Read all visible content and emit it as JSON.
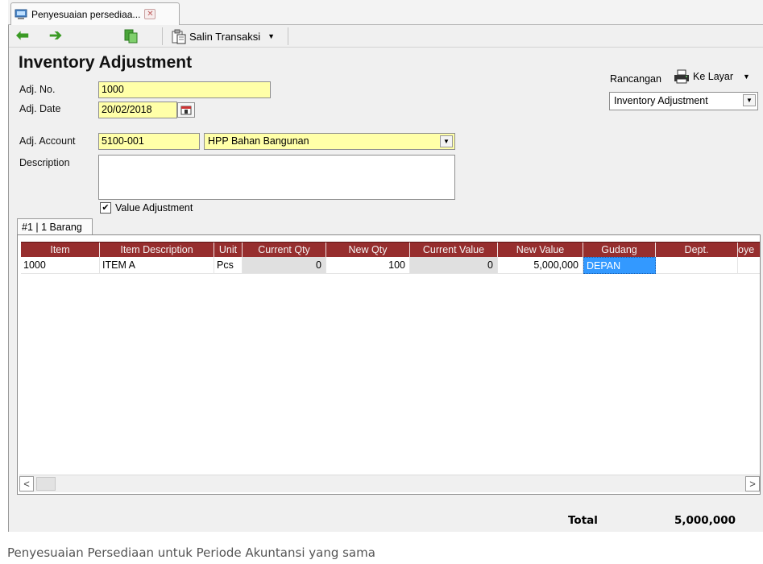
{
  "tab": {
    "title": "Penyesuaian persediaa...",
    "close_label": "✕"
  },
  "toolbar": {
    "back_icon": "arrow-left-icon",
    "forward_icon": "arrow-right-icon",
    "copy_icon": "copy-document-icon",
    "salin_label": "Salin Transaksi",
    "dropdown_caret": "▼"
  },
  "form": {
    "title": "Inventory Adjustment",
    "adj_no_label": "Adj. No.",
    "adj_no_value": "1000",
    "adj_date_label": "Adj. Date",
    "adj_date_value": "20/02/2018",
    "adj_account_label": "Adj. Account",
    "adj_account_code": "5100-001",
    "adj_account_name": "HPP Bahan Bangunan",
    "description_label": "Description",
    "description_value": "",
    "value_adjustment_label": "Value Adjustment",
    "value_adjustment_checked": true
  },
  "print": {
    "rancangan_label": "Rancangan",
    "ke_layar_label": "Ke Layar",
    "template_value": "Inventory Adjustment"
  },
  "grid": {
    "tab_label": "#1 | 1 Barang",
    "columns": [
      "Item",
      "Item Description",
      "Unit",
      "Current Qty",
      "New Qty",
      "Current Value",
      "New Value",
      "Gudang",
      "Dept.",
      "oye"
    ],
    "rows": [
      {
        "item": "1000",
        "description": "ITEM A",
        "unit": "Pcs",
        "current_qty": "0",
        "new_qty": "100",
        "current_value": "0",
        "new_value": "5,000,000",
        "gudang": "DEPAN",
        "dept": "",
        "extra": ""
      }
    ],
    "scroll_left": "<",
    "scroll_right": ">"
  },
  "totals": {
    "label": "Total",
    "value": "5,000,000"
  },
  "caption": "Penyesuaian Persediaan untuk Periode Akuntansi yang sama",
  "colors": {
    "header_bg": "#962e2e",
    "field_bg": "#ffffa8",
    "selected_cell": "#3399ff",
    "nav_arrow": "#3a9a24"
  }
}
